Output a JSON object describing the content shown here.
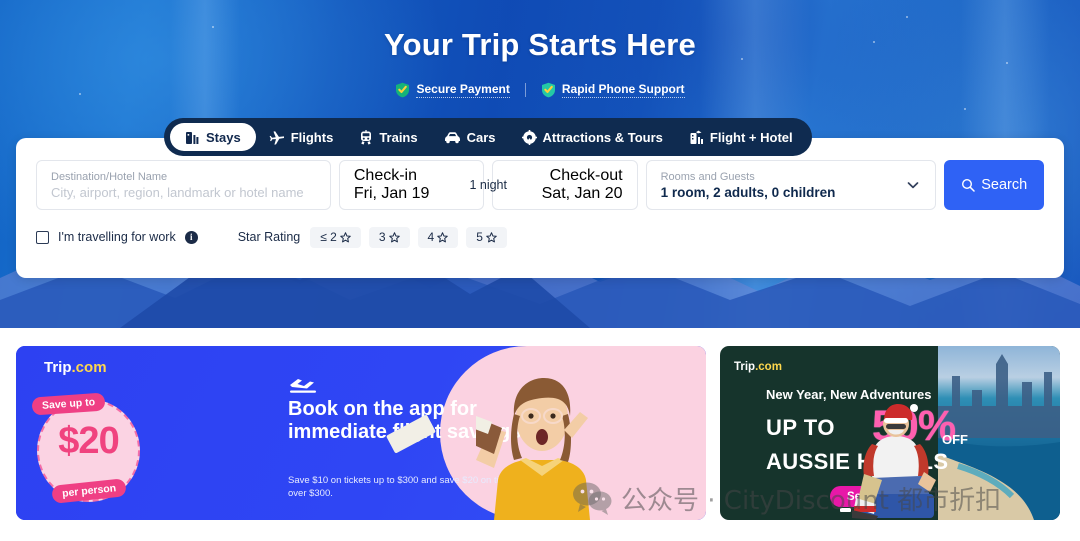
{
  "hero": {
    "title": "Your Trip Starts Here",
    "trust_badges": [
      {
        "label": "Secure Payment",
        "icon": "shield-check-icon"
      },
      {
        "label": "Rapid Phone Support",
        "icon": "shield-check-icon"
      }
    ]
  },
  "tabs": [
    {
      "label": "Stays",
      "icon": "building-icon",
      "active": true
    },
    {
      "label": "Flights",
      "icon": "plane-icon",
      "active": false
    },
    {
      "label": "Trains",
      "icon": "train-icon",
      "active": false
    },
    {
      "label": "Cars",
      "icon": "car-icon",
      "active": false
    },
    {
      "label": "Attractions & Tours",
      "icon": "ferris-wheel-icon",
      "active": false
    },
    {
      "label": "Flight + Hotel",
      "icon": "flight-hotel-icon",
      "active": false
    }
  ],
  "search": {
    "destination": {
      "label": "Destination/Hotel Name",
      "placeholder": "City, airport, region, landmark or hotel name",
      "value": ""
    },
    "checkin": {
      "label": "Check-in",
      "value": "Fri, Jan 19"
    },
    "nights": "1 night",
    "checkout": {
      "label": "Check-out",
      "value": "Sat, Jan 20"
    },
    "guests": {
      "label": "Rooms and Guests",
      "value": "1 room, 2 adults, 0 children"
    },
    "search_button": "Search",
    "search_icon": "magnifier-icon",
    "chevron_icon": "chevron-down-icon",
    "work_travel": {
      "label": "I'm travelling for work",
      "checked": false,
      "info_icon": "info-icon"
    },
    "star_rating_label": "Star Rating",
    "star_chips": [
      "≤ 2",
      "3",
      "4",
      "5"
    ],
    "star_icon": "star-outline-icon"
  },
  "promos": {
    "left": {
      "brand": "Trip",
      "brand_suffix": ".com",
      "badge_top": "Save up to",
      "badge_amount": "$20",
      "badge_bottom": "per person",
      "headline": "Book on the app for immediate flight savings",
      "subtext": "Save $10 on tickets up to $300 and save $20 on tickets over $300.",
      "plane_icon": "plane-takeoff-icon"
    },
    "right": {
      "brand": "Trip",
      "brand_suffix": ".com",
      "tagline": "New Year, New Adventures",
      "upto": "UP TO",
      "percent": "50%",
      "off": "OFF",
      "headline": "AUSSIE HOTELS",
      "cta": "See Deals",
      "dots": 5,
      "active_dot": 0
    }
  },
  "watermark": {
    "icon": "wechat-icon",
    "text": "公众号 · CityDiscount 都市折扣"
  }
}
